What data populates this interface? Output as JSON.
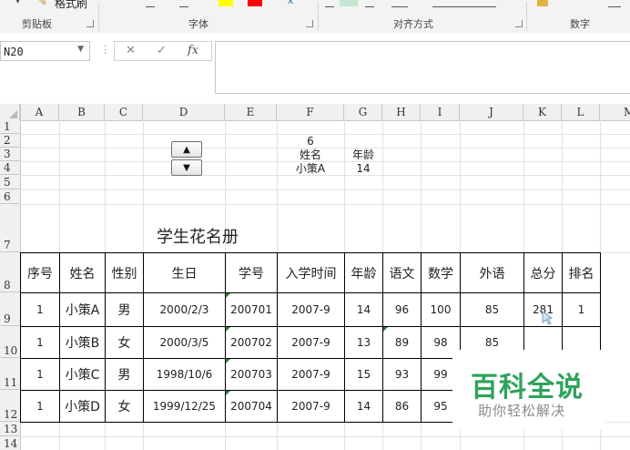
{
  "ribbon": {
    "format_painter": "格式刷",
    "groups": [
      "剪贴板",
      "字体",
      "对齐方式",
      "数字"
    ]
  },
  "formula_bar": {
    "name_box": "N20",
    "fx": "fx"
  },
  "columns": [
    "A",
    "B",
    "C",
    "D",
    "E",
    "F",
    "G",
    "H",
    "I",
    "J",
    "K",
    "L",
    "M"
  ],
  "rows": [
    "1",
    "2",
    "3",
    "4",
    "5",
    "6",
    "7",
    "8",
    "9",
    "10",
    "11",
    "12",
    "13",
    "14"
  ],
  "lookup": {
    "index_value": "6",
    "name_header": "姓名",
    "age_header": "年龄",
    "name_value": "小策A",
    "age_value": "14"
  },
  "table": {
    "title": "学生花名册",
    "headers": [
      "序号",
      "姓名",
      "性别",
      "生日",
      "学号",
      "入学时间",
      "年龄",
      "语文",
      "数学",
      "外语",
      "总分",
      "排名"
    ],
    "rows": [
      [
        "1",
        "小策A",
        "男",
        "2000/2/3",
        "200701",
        "2007-9",
        "14",
        "96",
        "100",
        "85",
        "281",
        "1"
      ],
      [
        "1",
        "小策B",
        "女",
        "2000/3/5",
        "200702",
        "2007-9",
        "13",
        "89",
        "98",
        "85",
        "",
        ""
      ],
      [
        "1",
        "小策C",
        "男",
        "1998/10/6",
        "200703",
        "2007-9",
        "15",
        "93",
        "99",
        "",
        "",
        ""
      ],
      [
        "1",
        "小策D",
        "女",
        "1999/12/25",
        "200704",
        "2007-9",
        "14",
        "86",
        "95",
        "",
        "",
        ""
      ]
    ]
  },
  "spinner": {
    "up": "▲",
    "down": "▼"
  },
  "watermark": {
    "title": "百科全说",
    "subtitle": "助你轻松解决"
  }
}
